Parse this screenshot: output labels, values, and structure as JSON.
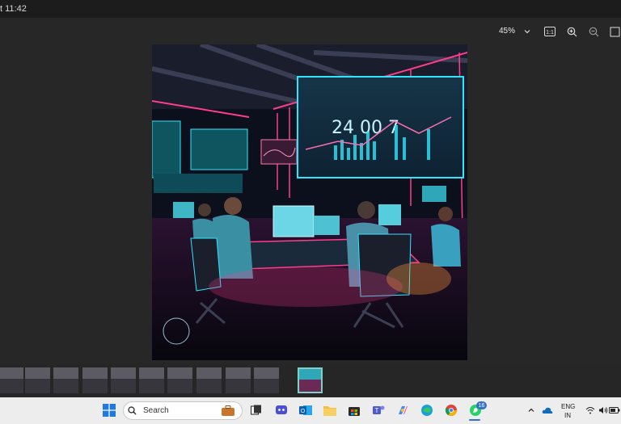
{
  "window": {
    "title": "t 11:42"
  },
  "toolbar": {
    "zoom": "45%",
    "actual_size_label": "1:1"
  },
  "taskbar": {
    "search_placeholder": "Search",
    "whatsapp_badge": "16",
    "tray": {
      "lang_line1": "ENG",
      "lang_line2": "IN"
    }
  },
  "photo": {
    "screen_text": "24 00 7",
    "subject": "neon-lit trading floor with people at computer desks"
  },
  "filmstrip": {
    "count": 11,
    "active_index": 10
  },
  "colors": {
    "accent": "#7ed0c8",
    "neon_pink": "#ff3d8a",
    "neon_cyan": "#2fe6ff"
  }
}
